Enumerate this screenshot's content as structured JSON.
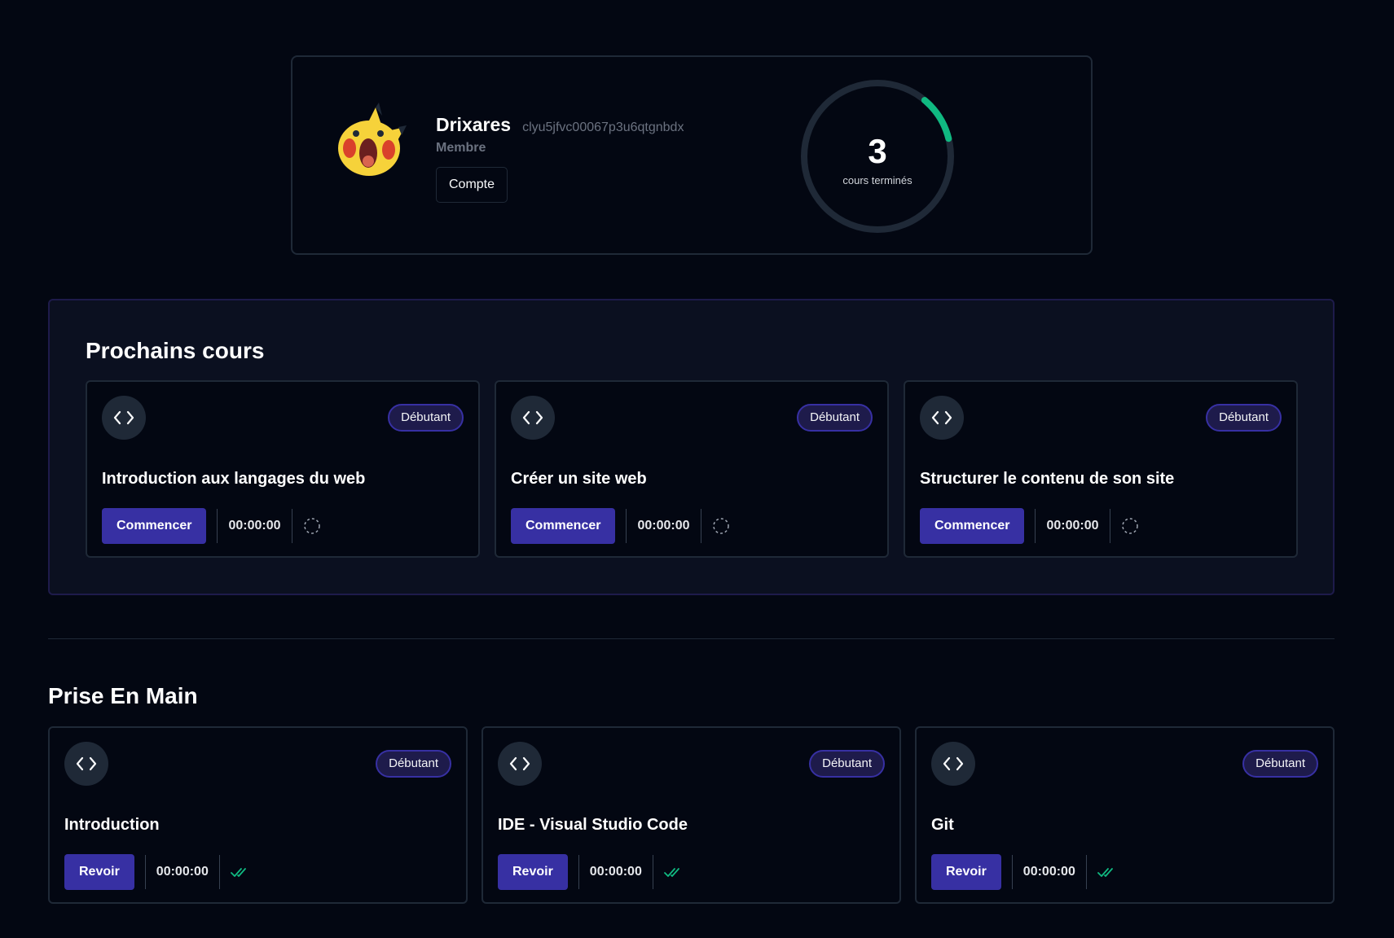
{
  "profile": {
    "username": "Drixares",
    "user_id": "clyu5jfvc00067p3u6qtgnbdx",
    "role": "Membre",
    "account_button": "Compte",
    "completed_count": "3",
    "completed_label": "cours terminés",
    "progress_fraction": 0.1,
    "colors": {
      "progress": "#10b981",
      "track": "#1f2937"
    }
  },
  "next_courses": {
    "title": "Prochains cours",
    "items": [
      {
        "level": "Débutant",
        "title": "Introduction aux langages du web",
        "action": "Commencer",
        "duration": "00:00:00",
        "status": "not-started"
      },
      {
        "level": "Débutant",
        "title": "Créer un site web",
        "action": "Commencer",
        "duration": "00:00:00",
        "status": "not-started"
      },
      {
        "level": "Débutant",
        "title": "Structurer le contenu de son site",
        "action": "Commencer",
        "duration": "00:00:00",
        "status": "not-started"
      }
    ]
  },
  "getting_started": {
    "title": "Prise En Main",
    "items": [
      {
        "level": "Débutant",
        "title": "Introduction",
        "action": "Revoir",
        "duration": "00:00:00",
        "status": "completed"
      },
      {
        "level": "Débutant",
        "title": "IDE - Visual Studio Code",
        "action": "Revoir",
        "duration": "00:00:00",
        "status": "completed"
      },
      {
        "level": "Débutant",
        "title": "Git",
        "action": "Revoir",
        "duration": "00:00:00",
        "status": "completed"
      }
    ]
  },
  "icons": {
    "course": "code-icon",
    "not_started": "dashed-circle-icon",
    "completed": "double-check-icon"
  },
  "accent": "#3730a3"
}
